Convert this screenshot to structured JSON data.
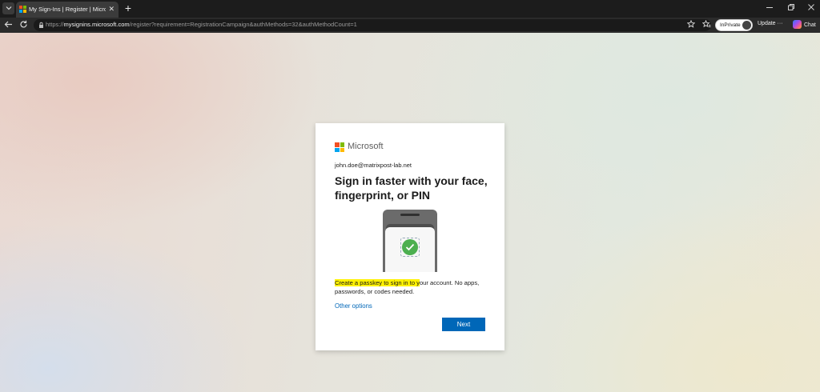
{
  "browser": {
    "tab": {
      "title": "My Sign-Ins | Register | Microsoft"
    },
    "address": {
      "protocol": "https://",
      "host": "mysignins.microsoft.com",
      "path": "/register?requirement=RegistrationCampaign&authMethods=32&authMethodCount=1"
    },
    "inprivate_label": "InPrivate",
    "update_label": "Update ···",
    "chat_label": "Chat",
    "icons": {
      "tab_menu": "chevron-down-icon",
      "new_tab": "plus-icon",
      "back": "back-arrow-icon",
      "refresh": "refresh-icon",
      "favorite": "star-icon",
      "favorites": "favorites-icon"
    }
  },
  "card": {
    "brand": "Microsoft",
    "brand_colors": [
      "#f25022",
      "#7fba00",
      "#00a4ef",
      "#ffb900"
    ],
    "email": "john.doe@matrixpost-lab.net",
    "heading": "Sign in faster with your face, fingerprint, or PIN",
    "description_highlighted": "Create a passkey to sign in to y",
    "description_rest": "our account. No apps, passwords, or codes needed.",
    "other_options": "Other options",
    "next_label": "Next",
    "accent_color": "#0067b8",
    "highlight_color": "#fff200",
    "check_color": "#4caf50"
  }
}
